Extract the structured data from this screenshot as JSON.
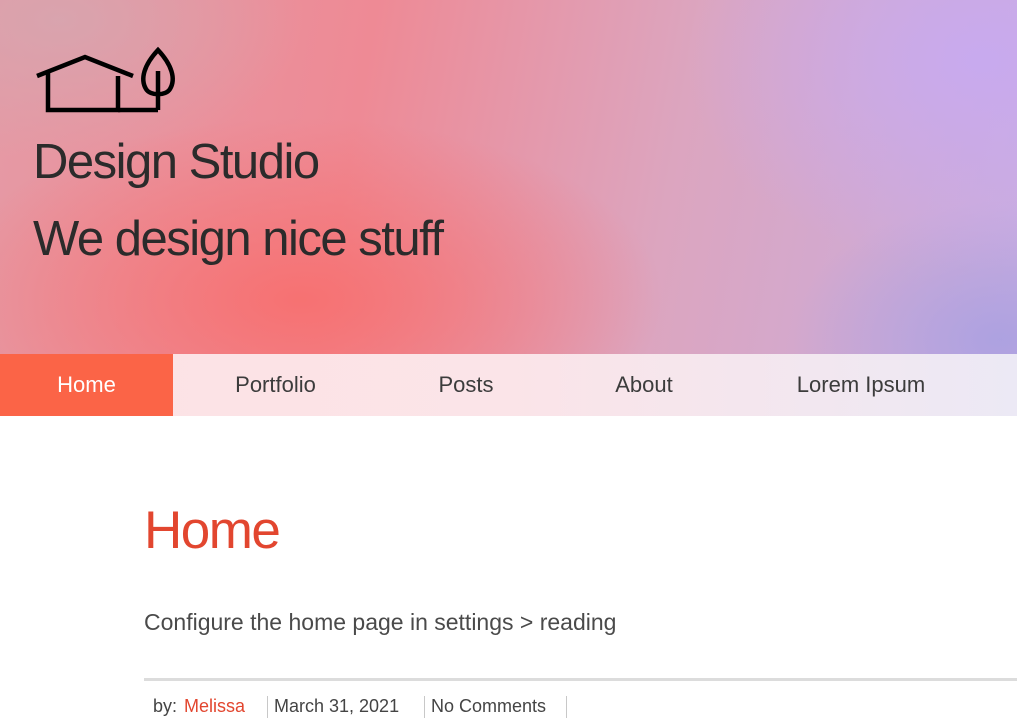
{
  "header": {
    "logo_icon": "house-with-tree-icon",
    "site_title": "Design Studio",
    "tagline": "We design nice stuff"
  },
  "nav": {
    "items": [
      {
        "label": "Home",
        "active": true
      },
      {
        "label": "Portfolio",
        "active": false
      },
      {
        "label": "Posts",
        "active": false
      },
      {
        "label": "About",
        "active": false
      },
      {
        "label": "Lorem Ipsum",
        "active": false
      }
    ]
  },
  "main": {
    "title": "Home",
    "body": "Configure the home page in settings > reading"
  },
  "meta": {
    "by_label": "by:",
    "author": "Melissa",
    "date": "March 31, 2021",
    "comments": "No Comments"
  },
  "colors": {
    "accent": "#fb6447",
    "title_red": "#e2462f",
    "text_dark": "#2b2b2b"
  }
}
